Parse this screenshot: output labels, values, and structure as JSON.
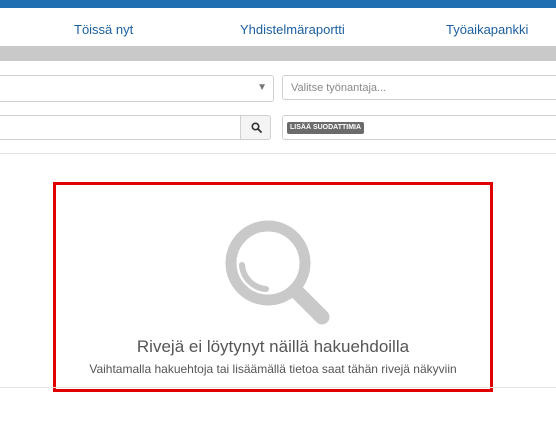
{
  "nav": {
    "items": [
      "Töissä nyt",
      "Yhdistelmäraportti",
      "Työaikapankki"
    ]
  },
  "filters": {
    "employer_placeholder": "Valitse työnantaja...",
    "add_filters_label": "LISÄÄ SUODATTIMIA"
  },
  "empty_state": {
    "title": "Rivejä ei löytynyt näillä hakuehdoilla",
    "subtitle": "Vaihtamalla hakuehtoja tai lisäämällä tietoa saat tähän rivejä näkyviin",
    "icon": "magnifier-icon",
    "highlight_color": "#e00000"
  },
  "colors": {
    "brand": "#1f6fb2",
    "nav_text": "#1c5fa0"
  }
}
